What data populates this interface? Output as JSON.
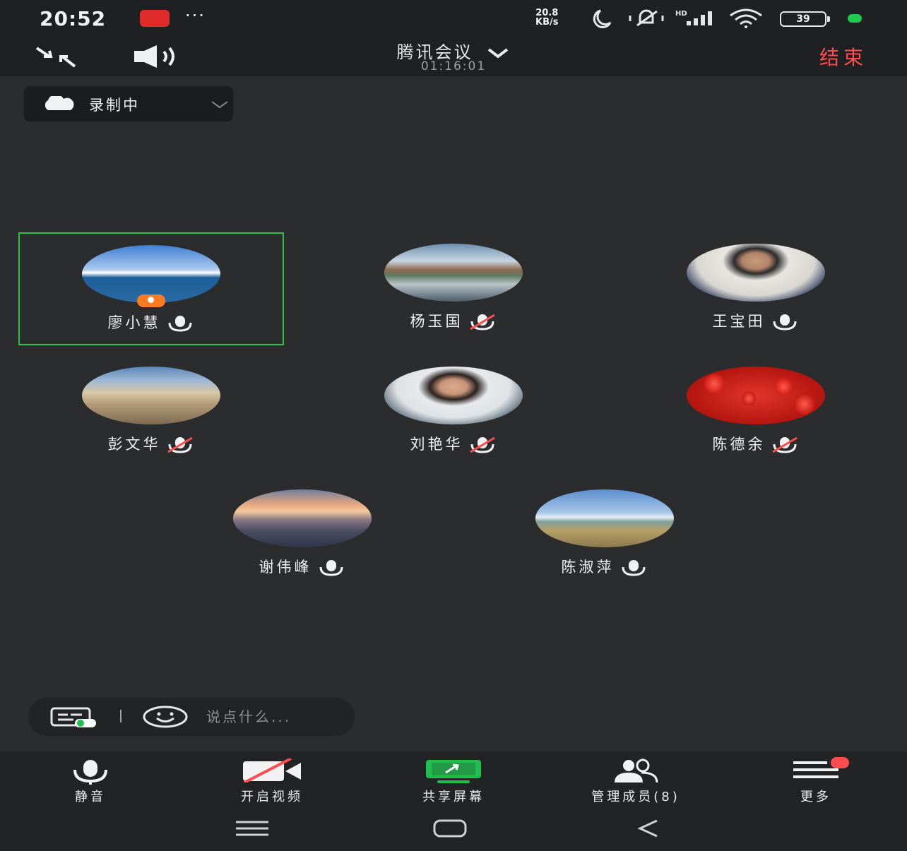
{
  "status_bar": {
    "time": "20:52",
    "dots": "···",
    "net_speed_value": "20.8",
    "net_speed_unit": "KB/s",
    "hd_label": "HD",
    "battery": "39"
  },
  "meeting": {
    "title": "腾讯会议",
    "timer": "01:16:01",
    "end_label": "结束"
  },
  "recording": {
    "label": "录制中"
  },
  "participants": [
    {
      "name": "廖小慧",
      "mic": "on",
      "host": true,
      "active": true
    },
    {
      "name": "杨玉国",
      "mic": "muted"
    },
    {
      "name": "王宝田",
      "mic": "on"
    },
    {
      "name": "彭文华",
      "mic": "muted"
    },
    {
      "name": "刘艳华",
      "mic": "muted"
    },
    {
      "name": "陈德余",
      "mic": "muted"
    },
    {
      "name": "谢伟峰",
      "mic": "on"
    },
    {
      "name": "陈淑萍",
      "mic": "on"
    }
  ],
  "chat": {
    "placeholder": "说点什么..."
  },
  "toolbar": {
    "mute_label": "静音",
    "video_label": "开启视频",
    "share_label": "共享屏幕",
    "members_label": "管理成员(8)",
    "more_label": "更多"
  },
  "colors": {
    "background": "#2b2c2e",
    "active_border": "#2ec24a",
    "end_red": "#ff4d4f",
    "share_green": "#1fbf4e",
    "host_orange": "#ff7a20"
  }
}
